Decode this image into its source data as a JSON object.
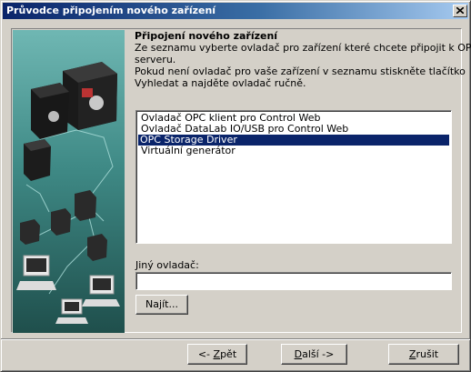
{
  "window": {
    "title": "Průvodce připojením nového zařízení"
  },
  "panel": {
    "heading": "Připojení nového zařízení",
    "description": [
      "Ze seznamu vyberte ovladač pro zařízení které chcete připojit k OPC",
      "serveru.",
      "Pokud není ovladač pro vaše zařízení v seznamu stiskněte tlačítko",
      "Vyhledat a najděte ovladač ručně."
    ]
  },
  "driver_list": {
    "items": [
      "Ovladač OPC klient pro Control Web",
      "Ovladač DataLab IO/USB pro Control Web",
      "OPC Storage Driver",
      "Virtuální generátor"
    ],
    "selected_index": 2
  },
  "other_driver": {
    "label": "Jiný ovladač:",
    "value": "",
    "find_button": {
      "pre": "Na",
      "mnemonic": "j",
      "post": "ít..."
    }
  },
  "buttons": {
    "back": {
      "pre": "<- ",
      "mnemonic": "Z",
      "post": "pět"
    },
    "next": {
      "pre": "",
      "mnemonic": "D",
      "post": "alší ->"
    },
    "cancel": {
      "pre": "",
      "mnemonic": "Z",
      "post": "rušit"
    }
  },
  "icons": {
    "close": "close-icon",
    "side_image": "hardware-network-illustration"
  }
}
